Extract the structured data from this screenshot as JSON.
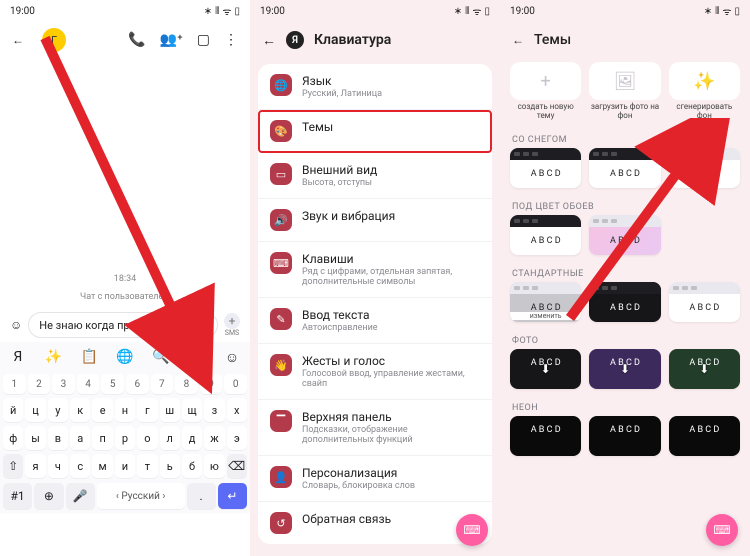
{
  "status": {
    "time": "19:00"
  },
  "chat": {
    "avatar_letter": "Г",
    "timestamp": "18:34",
    "info": "Чат с пользователем",
    "message_draft": "Не знаю когда приеду жди ти",
    "sms_label": "SMS"
  },
  "keyboard": {
    "toolbar": [
      "ya-logo",
      "magic",
      "clipboard",
      "translate",
      "search",
      "settings",
      "emoji"
    ],
    "num_row": [
      "1",
      "2",
      "3",
      "4",
      "5",
      "6",
      "7",
      "8",
      "9",
      "0"
    ],
    "row1": [
      "й",
      "ц",
      "у",
      "к",
      "е",
      "н",
      "г",
      "ш",
      "щ",
      "з",
      "х"
    ],
    "row2": [
      "ф",
      "ы",
      "в",
      "а",
      "п",
      "р",
      "о",
      "л",
      "д",
      "ж",
      "э"
    ],
    "row3_shift": "⇧",
    "row3": [
      "я",
      "ч",
      "с",
      "м",
      "и",
      "т",
      "ь",
      "б",
      "ю"
    ],
    "row3_bksp": "⌫",
    "bottom": {
      "num": "#1",
      "globe": "⊕",
      "mic": "🎤",
      "space": "‹ Русский ›",
      "dot": ".",
      "enter": "↵"
    }
  },
  "settings": {
    "header_back": "←",
    "header_logo": "Я",
    "header_title": "Клавиатура",
    "items": [
      {
        "icon": "🌐",
        "title": "Язык",
        "sub": "Русский, Латиница"
      },
      {
        "icon": "🎨",
        "title": "Темы",
        "sub": ""
      },
      {
        "icon": "▭",
        "title": "Внешний вид",
        "sub": "Высота, отступы"
      },
      {
        "icon": "🔊",
        "title": "Звук и вибрация",
        "sub": ""
      },
      {
        "icon": "⌨",
        "title": "Клавиши",
        "sub": "Ряд с цифрами, отдельная запятая, дополнительные символы"
      },
      {
        "icon": "✎",
        "title": "Ввод текста",
        "sub": "Автоисправление"
      },
      {
        "icon": "👋",
        "title": "Жесты и голос",
        "sub": "Голосовой ввод, управление жестами, свайп"
      },
      {
        "icon": "▔",
        "title": "Верхняя панель",
        "sub": "Подсказки, отображение дополнительных функций"
      },
      {
        "icon": "👤",
        "title": "Персонализация",
        "sub": "Словарь, блокировка слов"
      },
      {
        "icon": "↺",
        "title": "Обратная связь",
        "sub": ""
      }
    ]
  },
  "themes": {
    "header_back": "←",
    "header_title": "Темы",
    "actions": [
      {
        "icon": "+",
        "label": "создать новую тему"
      },
      {
        "icon": "🖼",
        "label": "загрузить фото на фон"
      },
      {
        "icon": "✨",
        "label": "сгенерировать фон"
      }
    ],
    "groups": {
      "snow": "СО СНЕГОМ",
      "wall": "ПОД ЦВЕТ ОБОЕВ",
      "std": "СТАНДАРТНЫЕ",
      "photo": "ФОТО",
      "neon": "НЕОН"
    },
    "card_keys": "A B C D",
    "change_label": "изменить"
  }
}
